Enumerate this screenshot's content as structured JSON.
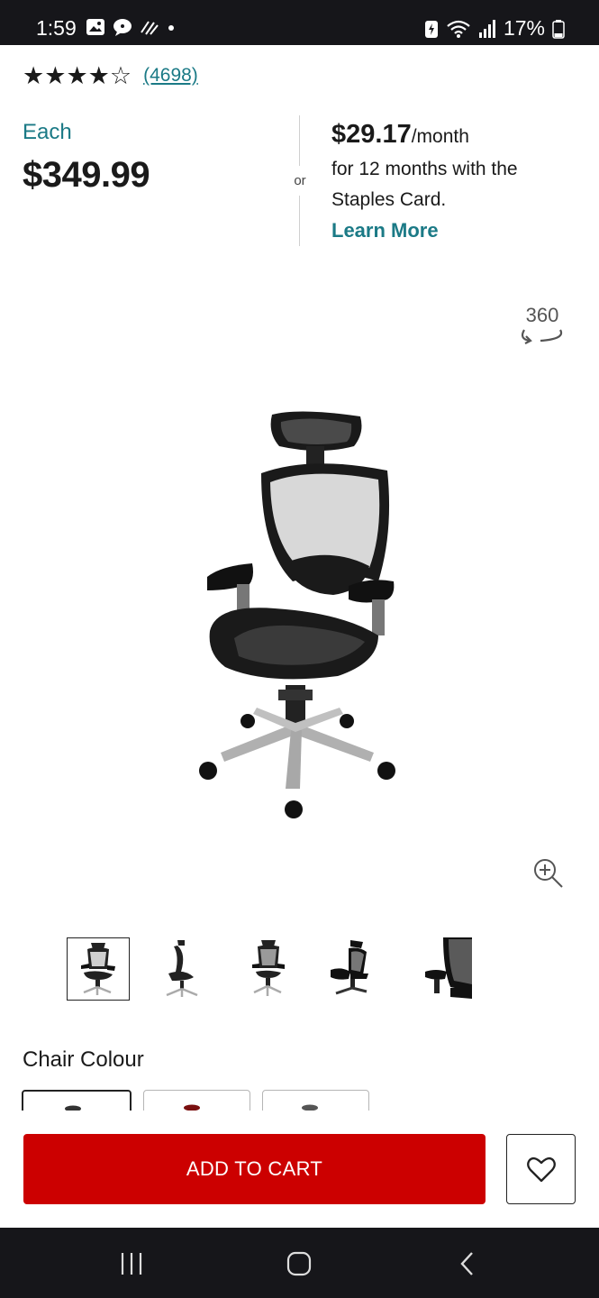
{
  "status_bar": {
    "time": "1:59",
    "battery": "17%",
    "icons_left": [
      "gallery-icon",
      "chat-icon",
      "signal-waves-icon",
      "dot-icon"
    ],
    "icons_right": [
      "battery-saver-icon",
      "wifi-icon",
      "signal-icon",
      "battery-icon"
    ]
  },
  "rating": {
    "stars": 4,
    "max_stars": 5,
    "review_count": "(4698)"
  },
  "pricing": {
    "each_label": "Each",
    "each_price": "$349.99",
    "or_label": "or",
    "monthly_price": "$29.17",
    "monthly_suffix": "/month",
    "financing_line1": "for 12 months with the",
    "financing_line2": "Staples Card.",
    "learn_more": "Learn More"
  },
  "gallery": {
    "view_360_label": "360",
    "thumbnail_count": 5,
    "selected_thumbnail": 0
  },
  "options": {
    "colour_label": "Chair Colour",
    "swatch_count": 3,
    "selected_swatch": 0
  },
  "actions": {
    "add_to_cart": "ADD TO CART"
  },
  "colors": {
    "accent_teal": "#1b7a86",
    "cart_red": "#cc0000",
    "system_bar": "#16161a"
  }
}
